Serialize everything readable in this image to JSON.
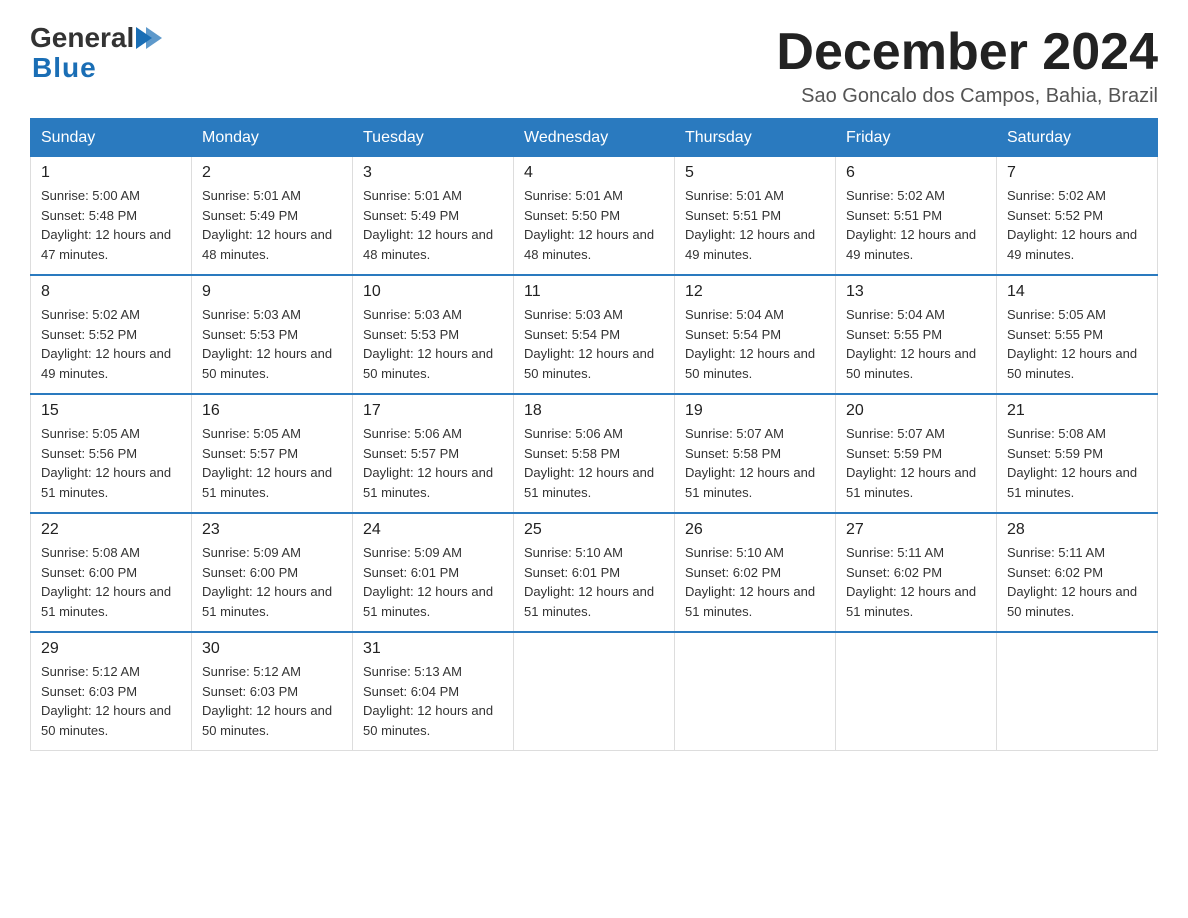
{
  "header": {
    "logo_general": "General",
    "logo_blue": "Blue",
    "month_title": "December 2024",
    "location": "Sao Goncalo dos Campos, Bahia, Brazil"
  },
  "days_of_week": [
    "Sunday",
    "Monday",
    "Tuesday",
    "Wednesday",
    "Thursday",
    "Friday",
    "Saturday"
  ],
  "weeks": [
    [
      {
        "day": "1",
        "sunrise": "Sunrise: 5:00 AM",
        "sunset": "Sunset: 5:48 PM",
        "daylight": "Daylight: 12 hours and 47 minutes."
      },
      {
        "day": "2",
        "sunrise": "Sunrise: 5:01 AM",
        "sunset": "Sunset: 5:49 PM",
        "daylight": "Daylight: 12 hours and 48 minutes."
      },
      {
        "day": "3",
        "sunrise": "Sunrise: 5:01 AM",
        "sunset": "Sunset: 5:49 PM",
        "daylight": "Daylight: 12 hours and 48 minutes."
      },
      {
        "day": "4",
        "sunrise": "Sunrise: 5:01 AM",
        "sunset": "Sunset: 5:50 PM",
        "daylight": "Daylight: 12 hours and 48 minutes."
      },
      {
        "day": "5",
        "sunrise": "Sunrise: 5:01 AM",
        "sunset": "Sunset: 5:51 PM",
        "daylight": "Daylight: 12 hours and 49 minutes."
      },
      {
        "day": "6",
        "sunrise": "Sunrise: 5:02 AM",
        "sunset": "Sunset: 5:51 PM",
        "daylight": "Daylight: 12 hours and 49 minutes."
      },
      {
        "day": "7",
        "sunrise": "Sunrise: 5:02 AM",
        "sunset": "Sunset: 5:52 PM",
        "daylight": "Daylight: 12 hours and 49 minutes."
      }
    ],
    [
      {
        "day": "8",
        "sunrise": "Sunrise: 5:02 AM",
        "sunset": "Sunset: 5:52 PM",
        "daylight": "Daylight: 12 hours and 49 minutes."
      },
      {
        "day": "9",
        "sunrise": "Sunrise: 5:03 AM",
        "sunset": "Sunset: 5:53 PM",
        "daylight": "Daylight: 12 hours and 50 minutes."
      },
      {
        "day": "10",
        "sunrise": "Sunrise: 5:03 AM",
        "sunset": "Sunset: 5:53 PM",
        "daylight": "Daylight: 12 hours and 50 minutes."
      },
      {
        "day": "11",
        "sunrise": "Sunrise: 5:03 AM",
        "sunset": "Sunset: 5:54 PM",
        "daylight": "Daylight: 12 hours and 50 minutes."
      },
      {
        "day": "12",
        "sunrise": "Sunrise: 5:04 AM",
        "sunset": "Sunset: 5:54 PM",
        "daylight": "Daylight: 12 hours and 50 minutes."
      },
      {
        "day": "13",
        "sunrise": "Sunrise: 5:04 AM",
        "sunset": "Sunset: 5:55 PM",
        "daylight": "Daylight: 12 hours and 50 minutes."
      },
      {
        "day": "14",
        "sunrise": "Sunrise: 5:05 AM",
        "sunset": "Sunset: 5:55 PM",
        "daylight": "Daylight: 12 hours and 50 minutes."
      }
    ],
    [
      {
        "day": "15",
        "sunrise": "Sunrise: 5:05 AM",
        "sunset": "Sunset: 5:56 PM",
        "daylight": "Daylight: 12 hours and 51 minutes."
      },
      {
        "day": "16",
        "sunrise": "Sunrise: 5:05 AM",
        "sunset": "Sunset: 5:57 PM",
        "daylight": "Daylight: 12 hours and 51 minutes."
      },
      {
        "day": "17",
        "sunrise": "Sunrise: 5:06 AM",
        "sunset": "Sunset: 5:57 PM",
        "daylight": "Daylight: 12 hours and 51 minutes."
      },
      {
        "day": "18",
        "sunrise": "Sunrise: 5:06 AM",
        "sunset": "Sunset: 5:58 PM",
        "daylight": "Daylight: 12 hours and 51 minutes."
      },
      {
        "day": "19",
        "sunrise": "Sunrise: 5:07 AM",
        "sunset": "Sunset: 5:58 PM",
        "daylight": "Daylight: 12 hours and 51 minutes."
      },
      {
        "day": "20",
        "sunrise": "Sunrise: 5:07 AM",
        "sunset": "Sunset: 5:59 PM",
        "daylight": "Daylight: 12 hours and 51 minutes."
      },
      {
        "day": "21",
        "sunrise": "Sunrise: 5:08 AM",
        "sunset": "Sunset: 5:59 PM",
        "daylight": "Daylight: 12 hours and 51 minutes."
      }
    ],
    [
      {
        "day": "22",
        "sunrise": "Sunrise: 5:08 AM",
        "sunset": "Sunset: 6:00 PM",
        "daylight": "Daylight: 12 hours and 51 minutes."
      },
      {
        "day": "23",
        "sunrise": "Sunrise: 5:09 AM",
        "sunset": "Sunset: 6:00 PM",
        "daylight": "Daylight: 12 hours and 51 minutes."
      },
      {
        "day": "24",
        "sunrise": "Sunrise: 5:09 AM",
        "sunset": "Sunset: 6:01 PM",
        "daylight": "Daylight: 12 hours and 51 minutes."
      },
      {
        "day": "25",
        "sunrise": "Sunrise: 5:10 AM",
        "sunset": "Sunset: 6:01 PM",
        "daylight": "Daylight: 12 hours and 51 minutes."
      },
      {
        "day": "26",
        "sunrise": "Sunrise: 5:10 AM",
        "sunset": "Sunset: 6:02 PM",
        "daylight": "Daylight: 12 hours and 51 minutes."
      },
      {
        "day": "27",
        "sunrise": "Sunrise: 5:11 AM",
        "sunset": "Sunset: 6:02 PM",
        "daylight": "Daylight: 12 hours and 51 minutes."
      },
      {
        "day": "28",
        "sunrise": "Sunrise: 5:11 AM",
        "sunset": "Sunset: 6:02 PM",
        "daylight": "Daylight: 12 hours and 50 minutes."
      }
    ],
    [
      {
        "day": "29",
        "sunrise": "Sunrise: 5:12 AM",
        "sunset": "Sunset: 6:03 PM",
        "daylight": "Daylight: 12 hours and 50 minutes."
      },
      {
        "day": "30",
        "sunrise": "Sunrise: 5:12 AM",
        "sunset": "Sunset: 6:03 PM",
        "daylight": "Daylight: 12 hours and 50 minutes."
      },
      {
        "day": "31",
        "sunrise": "Sunrise: 5:13 AM",
        "sunset": "Sunset: 6:04 PM",
        "daylight": "Daylight: 12 hours and 50 minutes."
      },
      {
        "day": "",
        "sunrise": "",
        "sunset": "",
        "daylight": ""
      },
      {
        "day": "",
        "sunrise": "",
        "sunset": "",
        "daylight": ""
      },
      {
        "day": "",
        "sunrise": "",
        "sunset": "",
        "daylight": ""
      },
      {
        "day": "",
        "sunrise": "",
        "sunset": "",
        "daylight": ""
      }
    ]
  ]
}
